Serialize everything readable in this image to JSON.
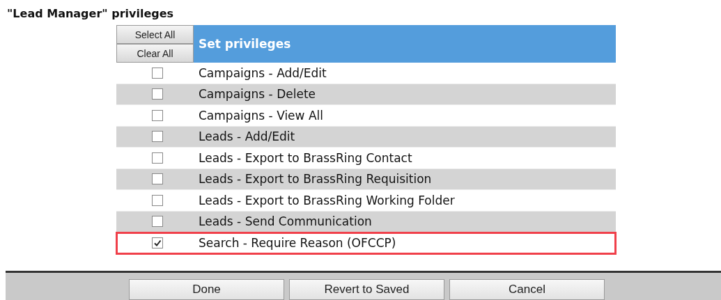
{
  "title": "\"Lead Manager\" privileges",
  "table": {
    "select_all": "Select All",
    "clear_all": "Clear All",
    "heading": "Set privileges",
    "rows": [
      {
        "label": "Campaigns - Add/Edit",
        "checked": false,
        "highlighted": false
      },
      {
        "label": "Campaigns - Delete",
        "checked": false,
        "highlighted": false
      },
      {
        "label": "Campaigns - View All",
        "checked": false,
        "highlighted": false
      },
      {
        "label": "Leads - Add/Edit",
        "checked": false,
        "highlighted": false
      },
      {
        "label": "Leads - Export to BrassRing Contact",
        "checked": false,
        "highlighted": false
      },
      {
        "label": "Leads - Export to BrassRing Requisition",
        "checked": false,
        "highlighted": false
      },
      {
        "label": "Leads - Export to BrassRing Working Folder",
        "checked": false,
        "highlighted": false
      },
      {
        "label": "Leads - Send Communication",
        "checked": false,
        "highlighted": false
      },
      {
        "label": "Search - Require Reason (OFCCP)",
        "checked": true,
        "highlighted": true
      }
    ]
  },
  "footer_buttons": [
    "Done",
    "Revert to Saved",
    "Cancel"
  ]
}
